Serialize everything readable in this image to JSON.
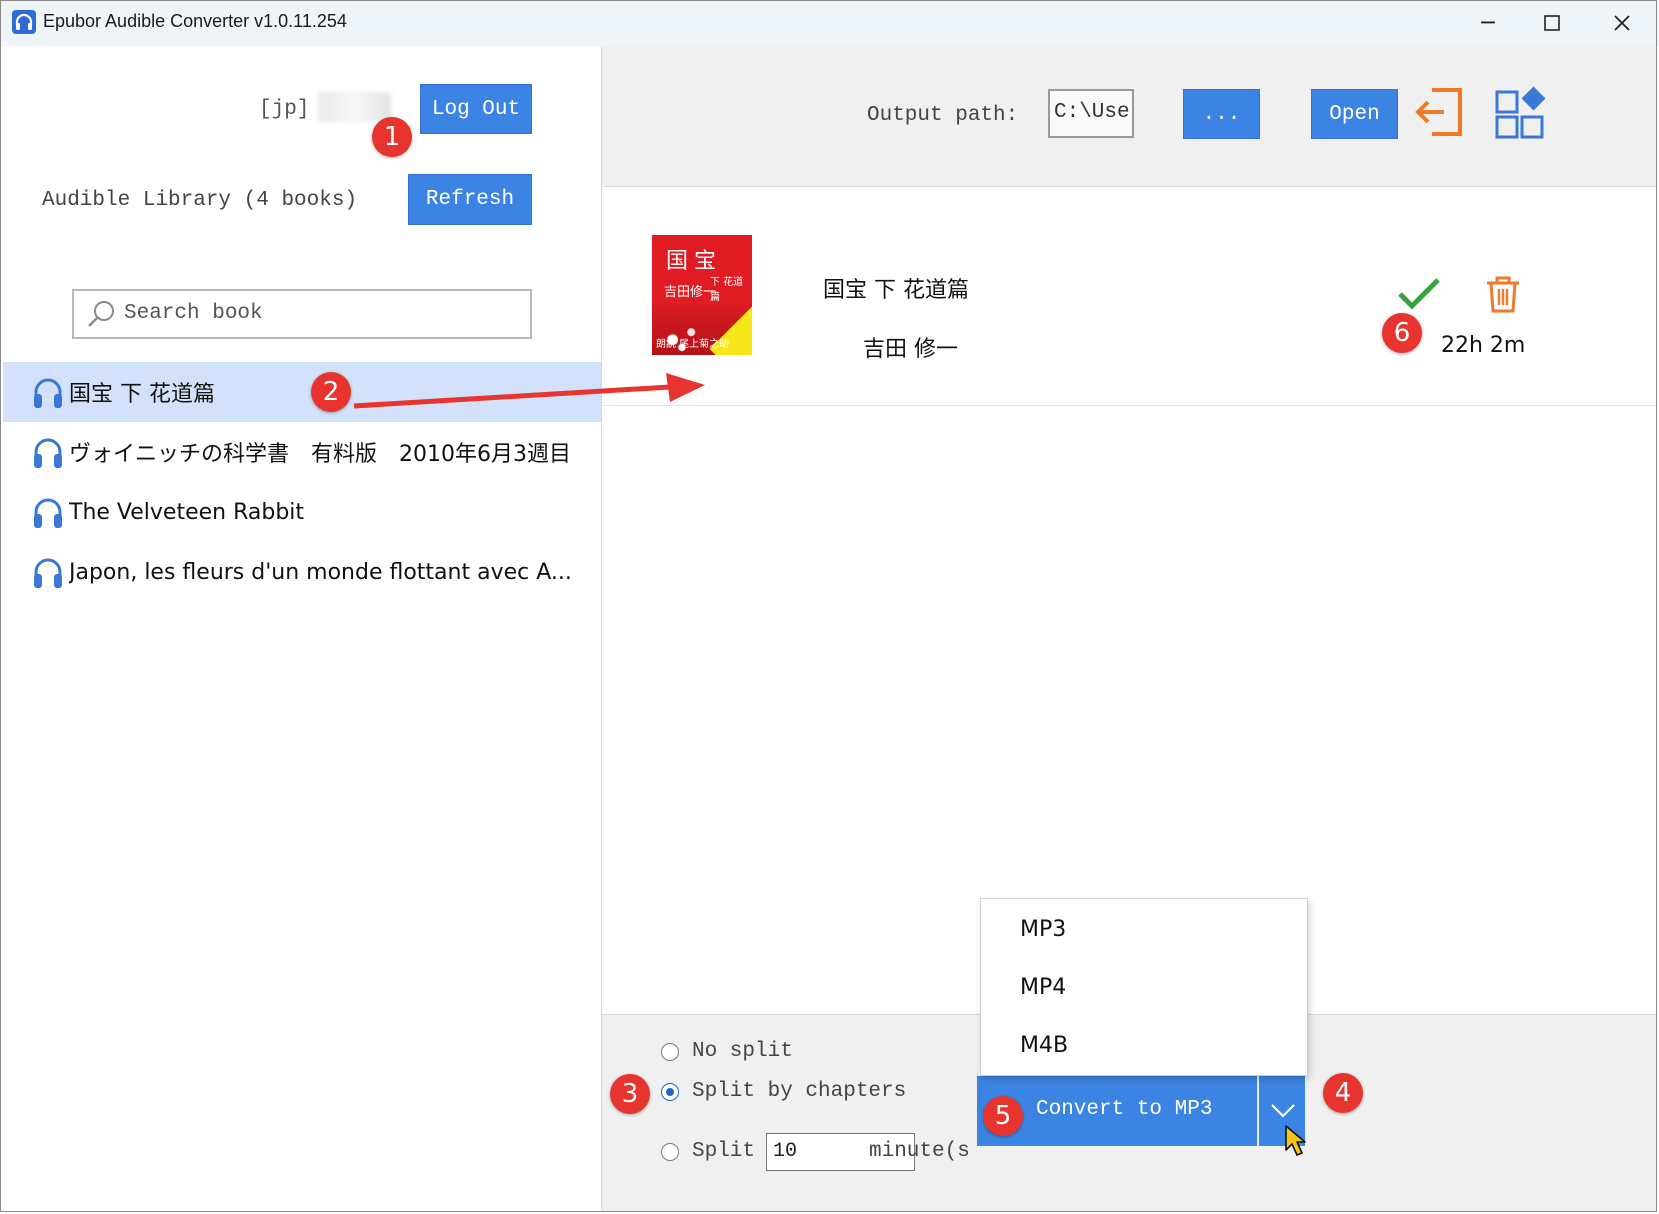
{
  "window": {
    "title": "Epubor Audible Converter v1.0.11.254",
    "minimize_glyph": "─",
    "maximize_glyph": "☐",
    "close_glyph": "✕"
  },
  "account": {
    "region_label": "[jp]",
    "logout_label": "Log Out"
  },
  "library": {
    "label": "Audible Library (4 books)",
    "refresh_label": "Refresh",
    "search_placeholder": "Search book",
    "books": [
      {
        "title": "国宝 下 花道篇",
        "selected": true
      },
      {
        "title": "ヴォイニッチの科学書　有料版　2010年6月3週目",
        "selected": false
      },
      {
        "title": "The Velveteen Rabbit",
        "selected": false
      },
      {
        "title": "Japon, les fleurs d'un monde flottant avec A...",
        "selected": false
      }
    ]
  },
  "output": {
    "label": "Output path:",
    "path_value": "C:\\User",
    "browse_label": "...",
    "open_label": "Open"
  },
  "queue": {
    "item": {
      "title": "国宝 下 花道篇",
      "author": "吉田 修一",
      "duration": "22h 2m",
      "status": "check-icon",
      "cover": {
        "title": "国宝",
        "subtitle": "下 花道篇",
        "author": "吉田修一",
        "bottom_text": "朗読 尾上菊之助"
      }
    }
  },
  "split": {
    "options": [
      {
        "label": "No split",
        "selected": false
      },
      {
        "label": "Split by chapters",
        "selected": true
      },
      {
        "label": "Split",
        "selected": false
      }
    ],
    "minutes_value": "10",
    "minutes_suffix": "minute(s"
  },
  "convert": {
    "label": "Convert to MP3",
    "formats": [
      "MP3",
      "MP4",
      "M4B"
    ]
  },
  "annotations": {
    "badges": [
      "1",
      "2",
      "3",
      "4",
      "5",
      "6"
    ],
    "badge_color": "#e8342e"
  },
  "colors": {
    "accent": "#3c84e3",
    "selected_row": "#d3e2fa",
    "check": "#3aa23a",
    "trash": "#f07a2a",
    "exit_icon": "#f07a2a"
  }
}
